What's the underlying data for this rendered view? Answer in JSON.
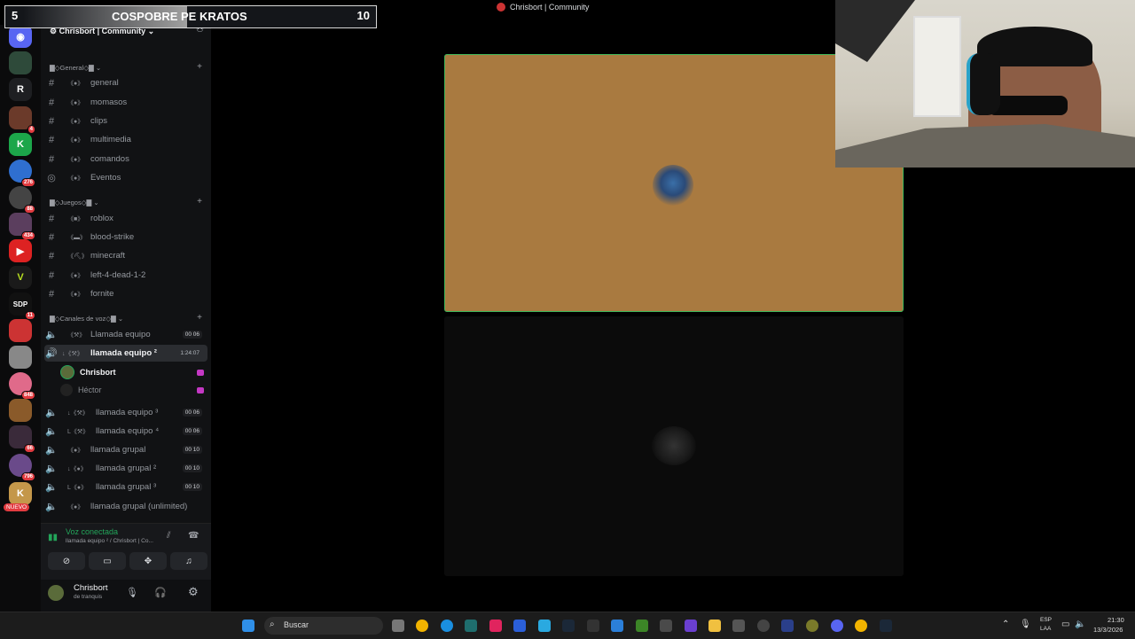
{
  "overlay": {
    "score_left": "5",
    "match_title": "COSPOBRE PE KRATOS",
    "score_right": "10"
  },
  "window": {
    "title": "Chrisbort | Community"
  },
  "rail": {
    "servers": [
      {
        "label": "",
        "badge": ""
      },
      {
        "label": "R",
        "badge": ""
      },
      {
        "label": "",
        "badge": "4"
      },
      {
        "label": "",
        "badge": ""
      },
      {
        "label": "",
        "badge": "276"
      },
      {
        "label": "",
        "badge": "88"
      },
      {
        "label": "",
        "badge": "434"
      },
      {
        "label": "",
        "badge": ""
      },
      {
        "label": "",
        "badge": ""
      },
      {
        "label": "SDP",
        "badge": "11"
      },
      {
        "label": "",
        "badge": ""
      },
      {
        "label": "",
        "badge": ""
      },
      {
        "label": "",
        "badge": "848"
      },
      {
        "label": "",
        "badge": ""
      },
      {
        "label": "",
        "badge": "66"
      },
      {
        "label": "",
        "badge": "796"
      },
      {
        "label": "",
        "badge": ""
      }
    ],
    "new_label": "NUEVO"
  },
  "sidebar": {
    "server_name": "Chrisbort | Community",
    "categories": {
      "general": "▇◇General◇▇",
      "juegos": "▇◇Juegos◇▇",
      "voz": "▇◇Canales de voz◇▇"
    },
    "text_channels": [
      {
        "icon": "#",
        "name": "general"
      },
      {
        "icon": "#",
        "name": "momasos"
      },
      {
        "icon": "#",
        "name": "clips"
      },
      {
        "icon": "#",
        "name": "multimedia"
      },
      {
        "icon": "#",
        "name": "comandos"
      },
      {
        "icon": "◎",
        "name": "Eventos"
      }
    ],
    "game_channels": [
      {
        "icon": "#",
        "name": "roblox"
      },
      {
        "icon": "#",
        "name": "blood-strike"
      },
      {
        "icon": "#",
        "name": "minecraft"
      },
      {
        "icon": "#",
        "name": "left-4-dead-1-2"
      },
      {
        "icon": "#",
        "name": "fornite"
      }
    ],
    "voice_channels": [
      {
        "name": "Llamada equipo",
        "count": "00  06"
      },
      {
        "name": "llamada equipo ²",
        "count": "1:24:07"
      },
      {
        "name": "llamada equipo ³",
        "count": "00  06"
      },
      {
        "name": "llamada equipo ⁴",
        "count": "00  06"
      },
      {
        "name": "llamada grupal",
        "count": "00  10"
      },
      {
        "name": "llamada grupal ²",
        "count": "00  10"
      },
      {
        "name": "llamada grupal ³",
        "count": "00  10"
      },
      {
        "name": "llamada grupal (unlimited)",
        "count": ""
      }
    ],
    "voice_users": [
      "Chrisbort",
      "Héctor"
    ]
  },
  "voice_panel": {
    "status": "Voz conectada",
    "detail": "llamada equipo ² / Chrisbort | Co..."
  },
  "user": {
    "name": "Chrisbort",
    "status": "de tranquis"
  },
  "taskbar": {
    "search_placeholder": "Buscar",
    "lang_top": "ESP",
    "lang_bottom": "LAA",
    "time": "21:30",
    "date": "13/3/2026"
  },
  "colors": {
    "accent_green": "#3fb75a",
    "tile_brown": "#a97a40",
    "badge_red": "#e23b40",
    "live_purple": "#c438c4"
  }
}
